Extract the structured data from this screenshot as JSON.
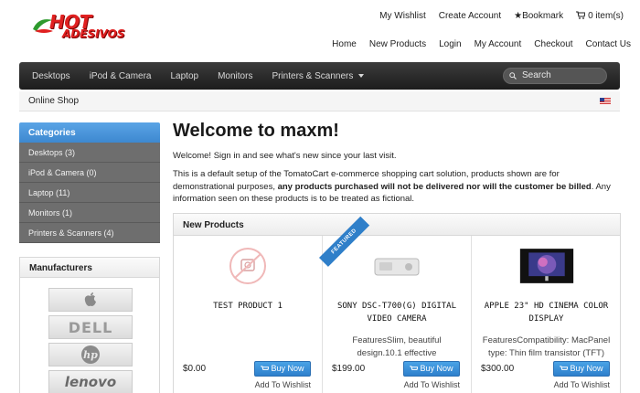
{
  "logo": {
    "word": "HOT",
    "sub": "ADESIVOS"
  },
  "top_links": {
    "wishlist": "My Wishlist",
    "create_account": "Create Account",
    "bookmark": "★Bookmark",
    "cart": "0 item(s)"
  },
  "nav": {
    "home": "Home",
    "new_products": "New Products",
    "login": "Login",
    "my_account": "My Account",
    "checkout": "Checkout",
    "contact": "Contact Us"
  },
  "menu": {
    "items": [
      "Desktops",
      "iPod & Camera",
      "Laptop",
      "Monitors",
      "Printers & Scanners"
    ]
  },
  "search": {
    "placeholder": "Search"
  },
  "breadcrumb": "Online Shop",
  "sidebar": {
    "categories_title": "Categories",
    "categories": [
      "Desktops (3)",
      "iPod & Camera (0)",
      "Laptop (11)",
      "Monitors (1)",
      "Printers & Scanners (4)"
    ],
    "manufacturers_title": "Manufacturers",
    "brands": {
      "dell": "DELL",
      "lenovo": "lenovo"
    }
  },
  "main": {
    "title": "Welcome to maxm!",
    "intro": "Welcome! Sign in and see what's new since your last visit.",
    "desc_part1": "This is a default setup of the TomatoCart e-commerce shopping cart solution, products shown are for demonstrational purposes, ",
    "desc_bold": "any products purchased will not be delivered nor will the customer be billed",
    "desc_part2": ". Any information seen on these products is to be treated as fictional."
  },
  "new_products": {
    "title": "New Products",
    "buy_label": "Buy Now",
    "wishlist_label": "Add To Wishlist",
    "ribbon": "FEATURED",
    "products": [
      {
        "name": "TEST PRODUCT 1",
        "desc": "",
        "price": "$0.00"
      },
      {
        "name": "SONY DSC-T700(G) DIGITAL VIDEO CAMERA",
        "desc": "FeaturesSlim, beautiful design.10.1 effective",
        "price": "$199.00"
      },
      {
        "name": "APPLE 23\" HD CINEMA COLOR DISPLAY",
        "desc": "FeaturesCompatibility: MacPanel type: Thin film transistor (TFT)",
        "price": "$300.00"
      }
    ]
  },
  "colors": {
    "accent": "#3d88d0",
    "menu_bg": "#2a2a2a",
    "logo_red": "#e02020"
  }
}
